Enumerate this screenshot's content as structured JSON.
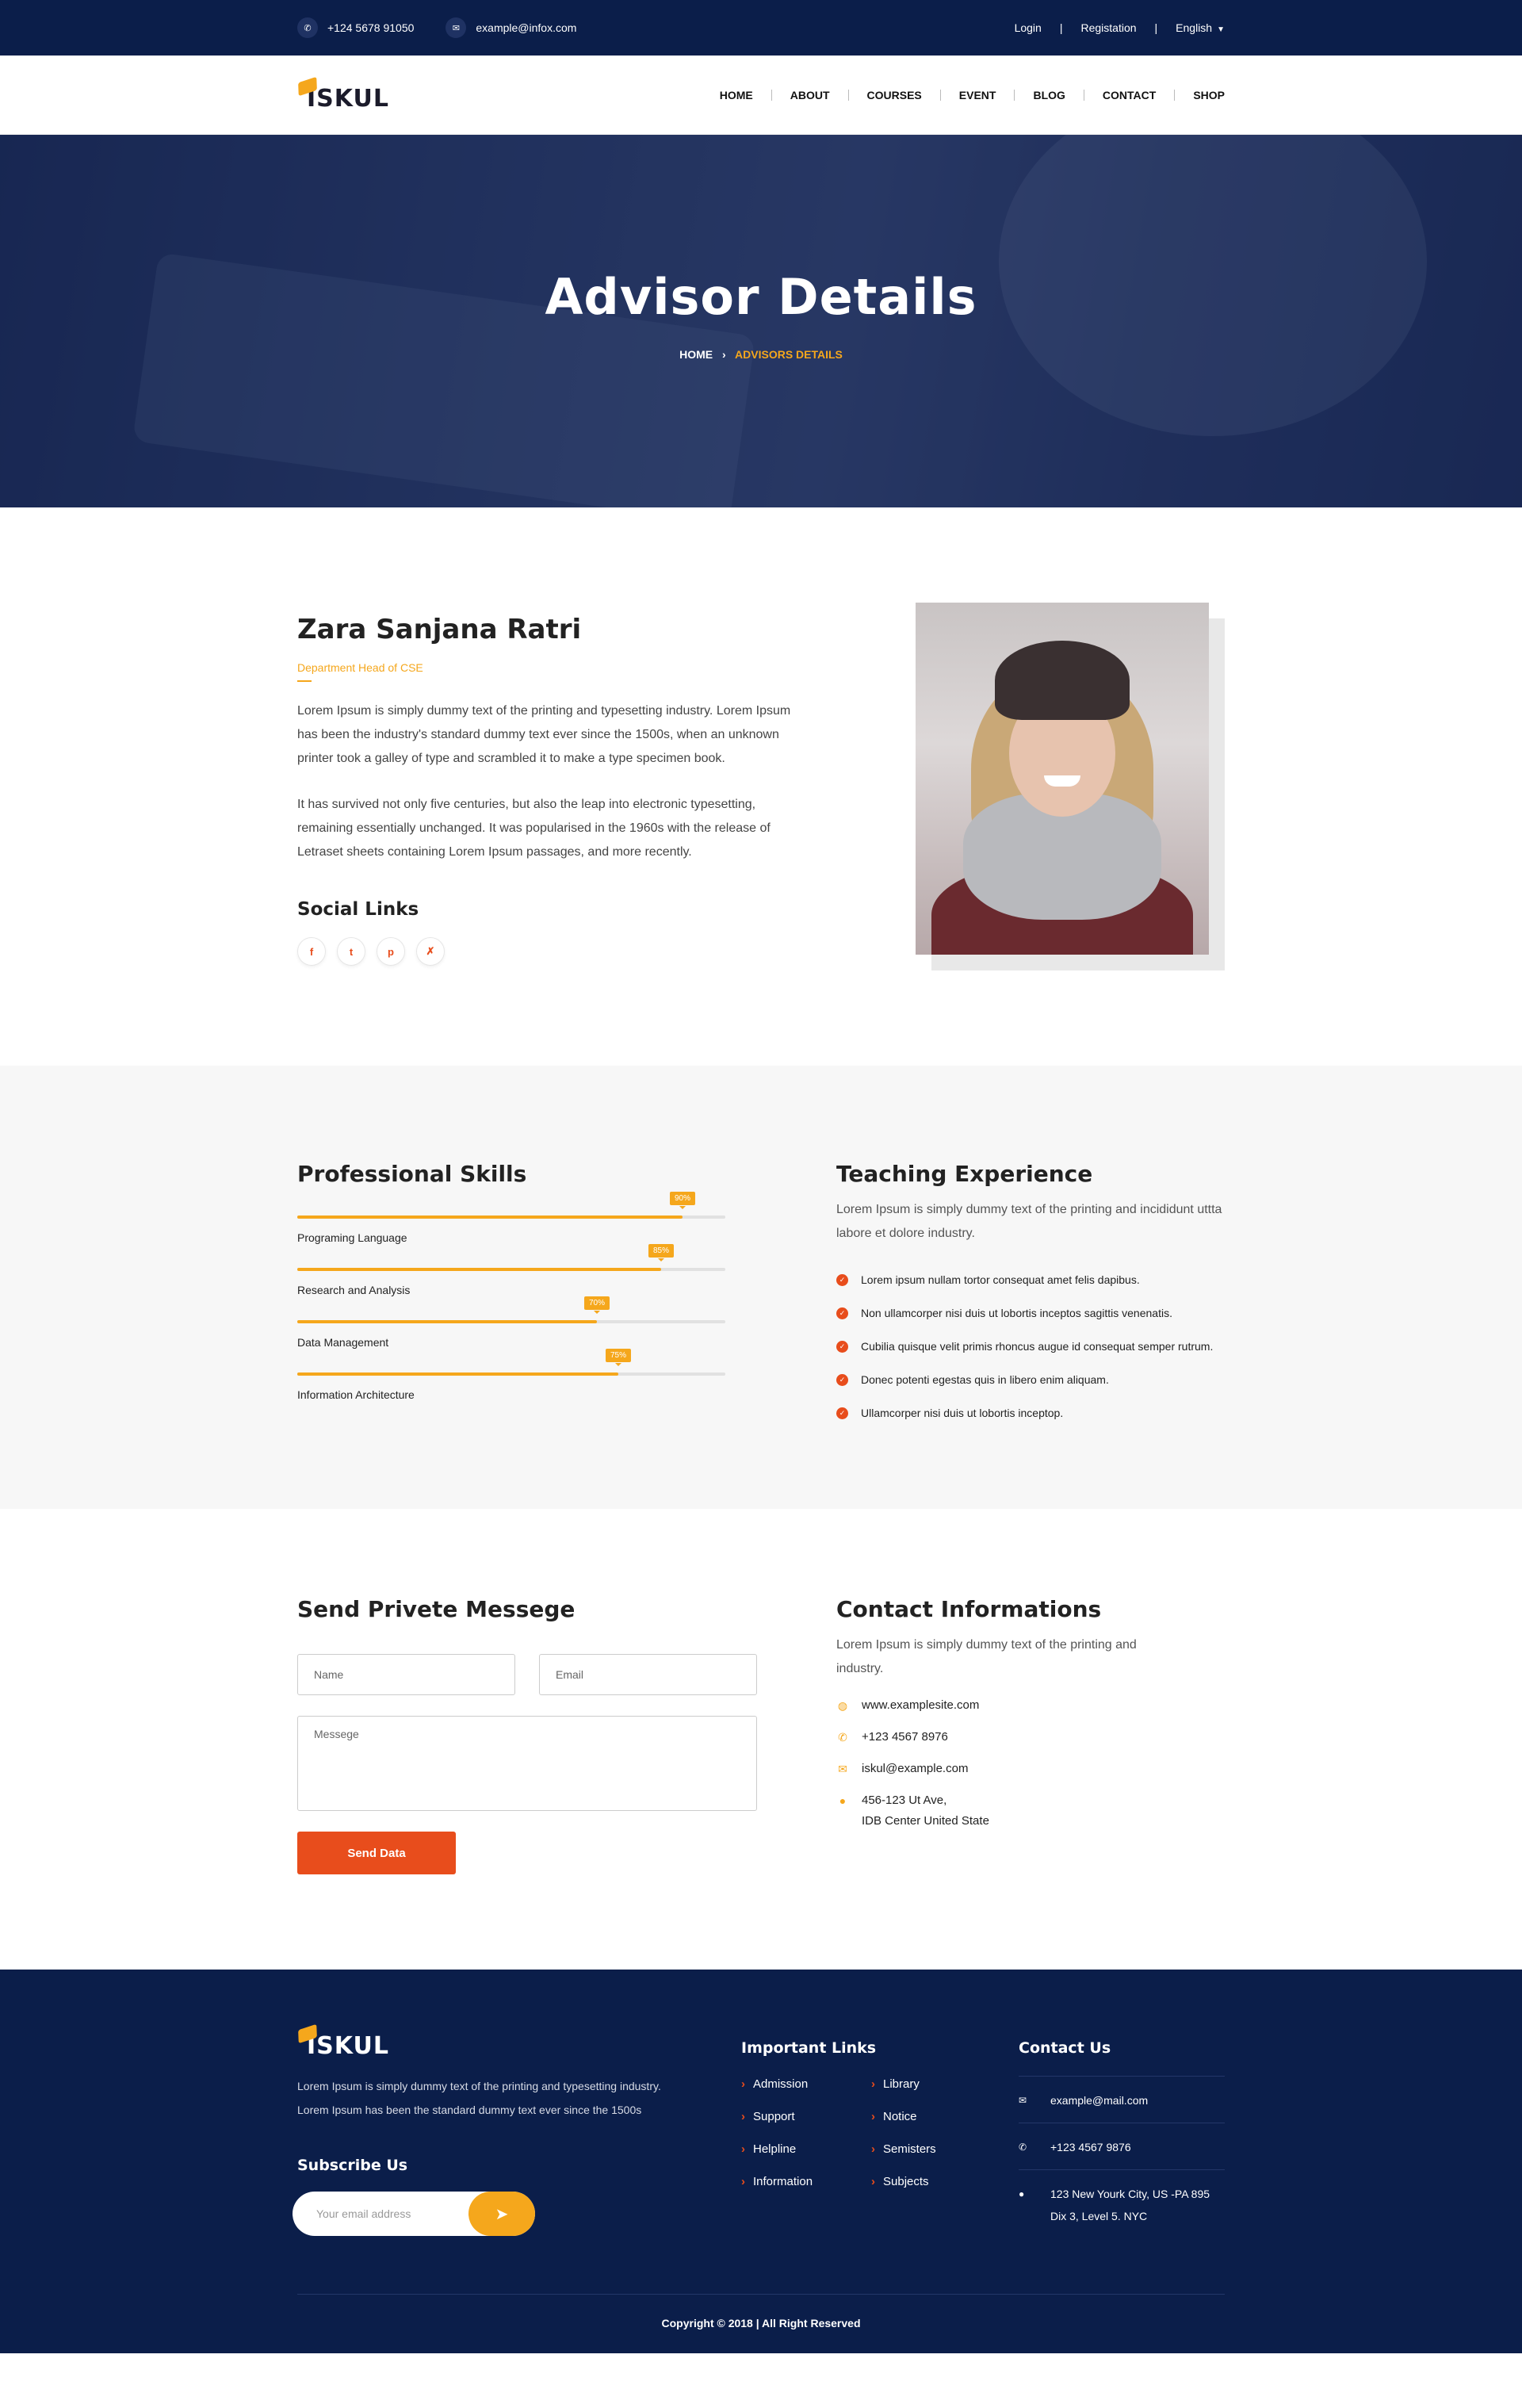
{
  "topbar": {
    "phone": "+124 5678 91050",
    "email": "example@infox.com",
    "login": "Login",
    "registration": "Registation",
    "language": "English"
  },
  "brand": {
    "name": "ISKUL",
    "accent": "#f5a71c",
    "navy": "#0b1e4a",
    "orange": "#e84d1c"
  },
  "nav": [
    "HOME",
    "ABOUT",
    "COURSES",
    "EVENT",
    "BLOG",
    "CONTACT",
    "SHOP"
  ],
  "hero": {
    "title": "Advisor Details",
    "breadcrumb_home": "HOME",
    "breadcrumb_current": "ADVISORS DETAILS"
  },
  "advisor": {
    "name": "Zara Sanjana Ratri",
    "role": "Department Head of CSE",
    "paragraph1": "Lorem Ipsum is simply dummy text of the printing and typesetting industry. Lorem Ipsum has been the industry's standard dummy text ever since the 1500s, when an unknown printer took a galley of type and scrambled it to make a type specimen book.",
    "paragraph2": "It has survived not only five centuries, but also the leap into electronic typesetting, remaining essentially unchanged. It was popularised in the 1960s with the release of Letraset sheets containing Lorem Ipsum passages, and more recently.",
    "social_heading": "Social Links",
    "socials": [
      "facebook-icon",
      "twitter-icon",
      "pinterest-icon",
      "xing-icon"
    ]
  },
  "skills": {
    "heading": "Professional Skills",
    "items": [
      {
        "label": "Programing Language",
        "percent": 90,
        "tip": "90%"
      },
      {
        "label": "Research and Analysis",
        "percent": 85,
        "tip": "85%"
      },
      {
        "label": "Data Management",
        "percent": 70,
        "tip": "70%"
      },
      {
        "label": "Information Architecture",
        "percent": 75,
        "tip": "75%"
      }
    ]
  },
  "teaching": {
    "heading": "Teaching Experience",
    "intro": "Lorem Ipsum is simply dummy text of the printing and incididunt uttta labore et dolore industry.",
    "items": [
      "Lorem ipsum nullam tortor consequat amet felis dapibus.",
      "Non ullamcorper nisi duis ut lobortis inceptos sagittis venenatis.",
      "Cubilia quisque velit primis rhoncus augue id consequat semper rutrum.",
      "Donec potenti egestas quis in libero enim aliquam.",
      "Ullamcorper nisi duis ut lobortis inceptop."
    ]
  },
  "message_form": {
    "heading": "Send Privete Messege",
    "name_placeholder": "Name",
    "email_placeholder": "Email",
    "message_placeholder": "Messege",
    "submit": "Send Data"
  },
  "contact_info": {
    "heading": "Contact Informations",
    "intro": "Lorem Ipsum is simply dummy text of the printing and industry.",
    "website": "www.examplesite.com",
    "phone": "+123 4567 8976",
    "email": "iskul@example.com",
    "address_line1": "456-123 Ut Ave,",
    "address_line2": "IDB Center United State"
  },
  "footer": {
    "about": "Lorem Ipsum is simply dummy text of the printing and typesetting industry. Lorem Ipsum has been the standard dummy text ever since the 1500s",
    "subscribe_heading": "Subscribe Us",
    "subscribe_placeholder": "Your email address",
    "links_heading": "Important Links",
    "links": [
      "Admission",
      "Library",
      "Support",
      "Notice",
      "Helpline",
      "Semisters",
      "Information",
      "Subjects"
    ],
    "contact_heading": "Contact Us",
    "contact_email": "example@mail.com",
    "contact_phone": "+123 4567 9876",
    "contact_address_line1": "123 New Yourk City, US -PA 895",
    "contact_address_line2": "Dix 3, Level 5. NYC",
    "copyright": "Copyright © 2018 |  All Right Reserved"
  }
}
